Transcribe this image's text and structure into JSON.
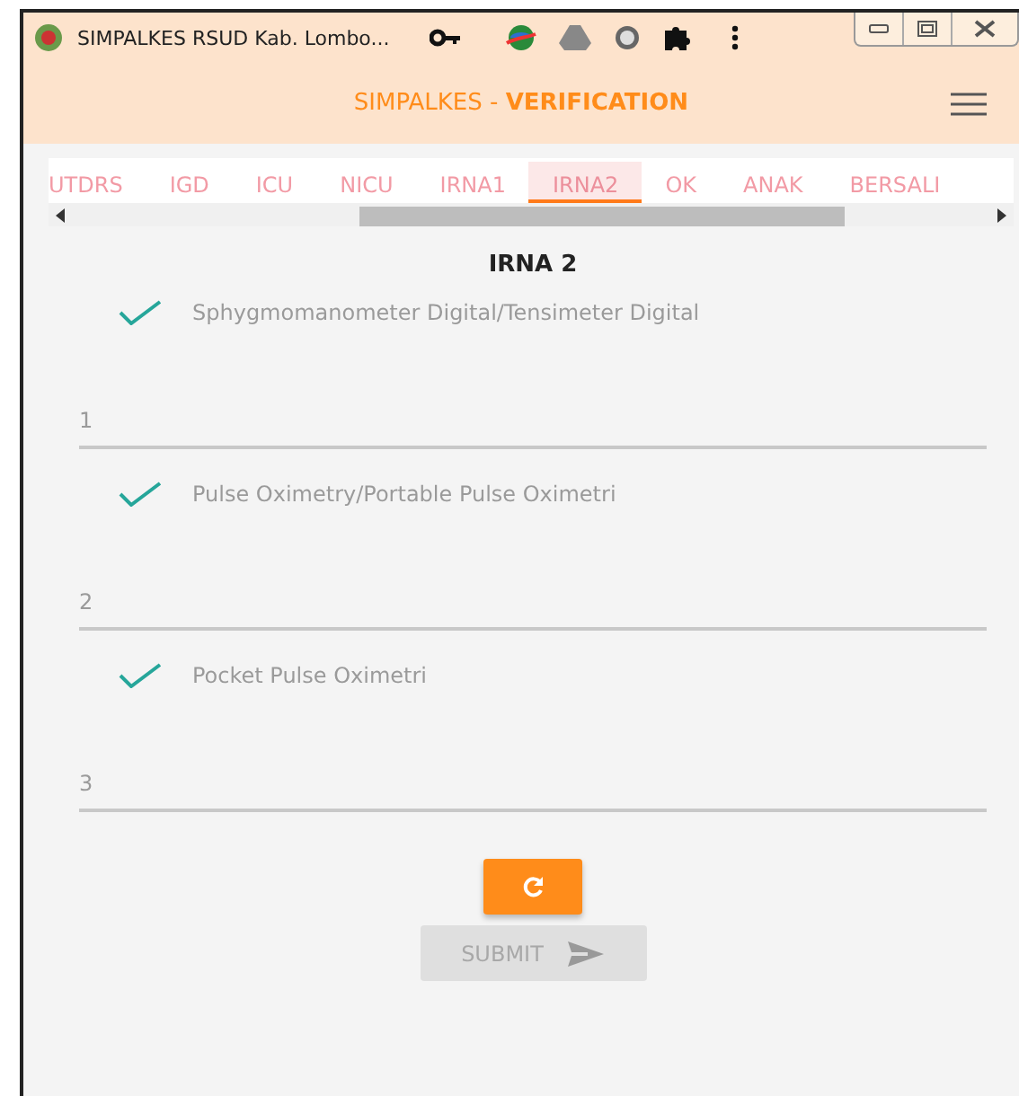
{
  "window": {
    "title": "SIMPALKES RSUD Kab. Lombo..."
  },
  "header": {
    "title": "SIMPALKES - ",
    "title_bold": "VERIFICATION"
  },
  "tabs": [
    {
      "label": "UTDRS",
      "selected": false
    },
    {
      "label": "IGD",
      "selected": false
    },
    {
      "label": "ICU",
      "selected": false
    },
    {
      "label": "NICU",
      "selected": false
    },
    {
      "label": "IRNA1",
      "selected": false
    },
    {
      "label": "IRNA2",
      "selected": true
    },
    {
      "label": "OK",
      "selected": false
    },
    {
      "label": "ANAK",
      "selected": false
    },
    {
      "label": "BERSALI",
      "selected": false
    }
  ],
  "section_title": "IRNA 2",
  "items": [
    {
      "label": "Sphygmomanometer Digital/Tensimeter Digital",
      "checked": true,
      "value": "1"
    },
    {
      "label": "Pulse Oximetry/Portable Pulse Oximetri",
      "checked": true,
      "value": "2"
    },
    {
      "label": "Pocket Pulse Oximetri",
      "checked": true,
      "value": "3"
    }
  ],
  "submit": {
    "label": "SUBMIT",
    "disabled": true
  }
}
